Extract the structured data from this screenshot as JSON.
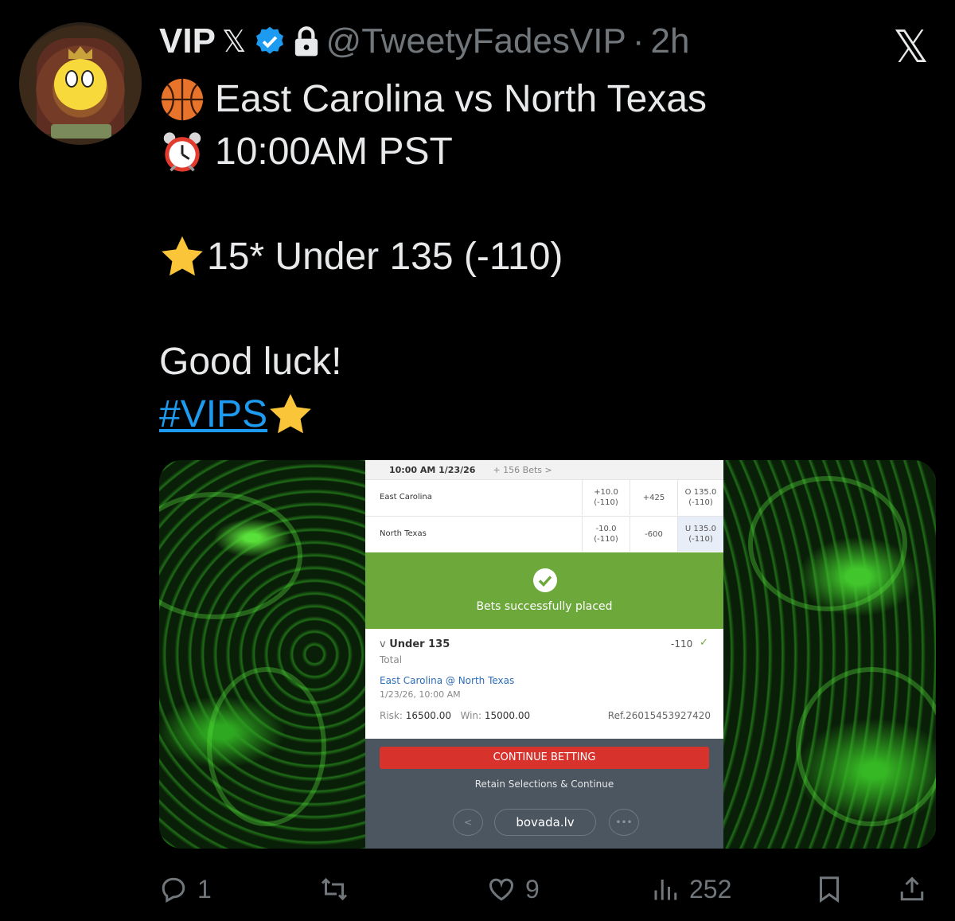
{
  "tweet": {
    "author_name": "VIP",
    "author_badge": "𝕏",
    "handle": "@TweetyFadesVIP",
    "separator": "·",
    "age": "2h",
    "platform_logo": "𝕏",
    "lines": {
      "game": "East Carolina vs North Texas",
      "time": "10:00AM PST",
      "pick": "15* Under 135 (-110)",
      "signoff": "Good luck!",
      "hashtag": "#VIPS"
    },
    "icons": {
      "game": "basketball-emoji",
      "time": "alarm-clock-emoji",
      "pick": "star-emoji",
      "hashtag": "star-emoji"
    }
  },
  "bet_slip": {
    "date": "10:00 AM 1/23/26",
    "more_bets": "+ 156 Bets >",
    "rows": [
      {
        "team": "East Carolina",
        "spread": "+10.0",
        "spread_odds": "(-110)",
        "moneyline": "+425",
        "total": "O 135.0",
        "total_odds": "(-110)"
      },
      {
        "team": "North Texas",
        "spread": "-10.0",
        "spread_odds": "(-110)",
        "moneyline": "-600",
        "total": "U 135.0",
        "total_odds": "(-110)"
      }
    ],
    "success_message": "Bets successfully placed",
    "selection": "Under 135",
    "selection_caret": "v",
    "bet_type": "Total",
    "odds": "-110",
    "check": "✓",
    "matchup": "East Carolina @ North Texas",
    "event_time": "1/23/26, 10:00 AM",
    "risk_label": "Risk:",
    "risk": "16500.00",
    "win_label": "Win:",
    "win": "15000.00",
    "ref": "Ref.26015453927420",
    "continue_label": "CONTINUE BETTING",
    "retain_label": "Retain Selections & Continue",
    "back_label": "<",
    "more_label": "•••",
    "site": "bovada.lv",
    "colors": {
      "success": "#6ca83a",
      "continue": "#d8322d",
      "footer": "#4b5661",
      "link": "#2d6db8"
    }
  },
  "actions": {
    "replies": "1",
    "reposts": "",
    "likes": "9",
    "views": "252"
  },
  "colors": {
    "background": "#000000",
    "text": "#e7e9ea",
    "muted": "#71767b",
    "link": "#1d9bf0",
    "verified": "#1d9bf0"
  }
}
